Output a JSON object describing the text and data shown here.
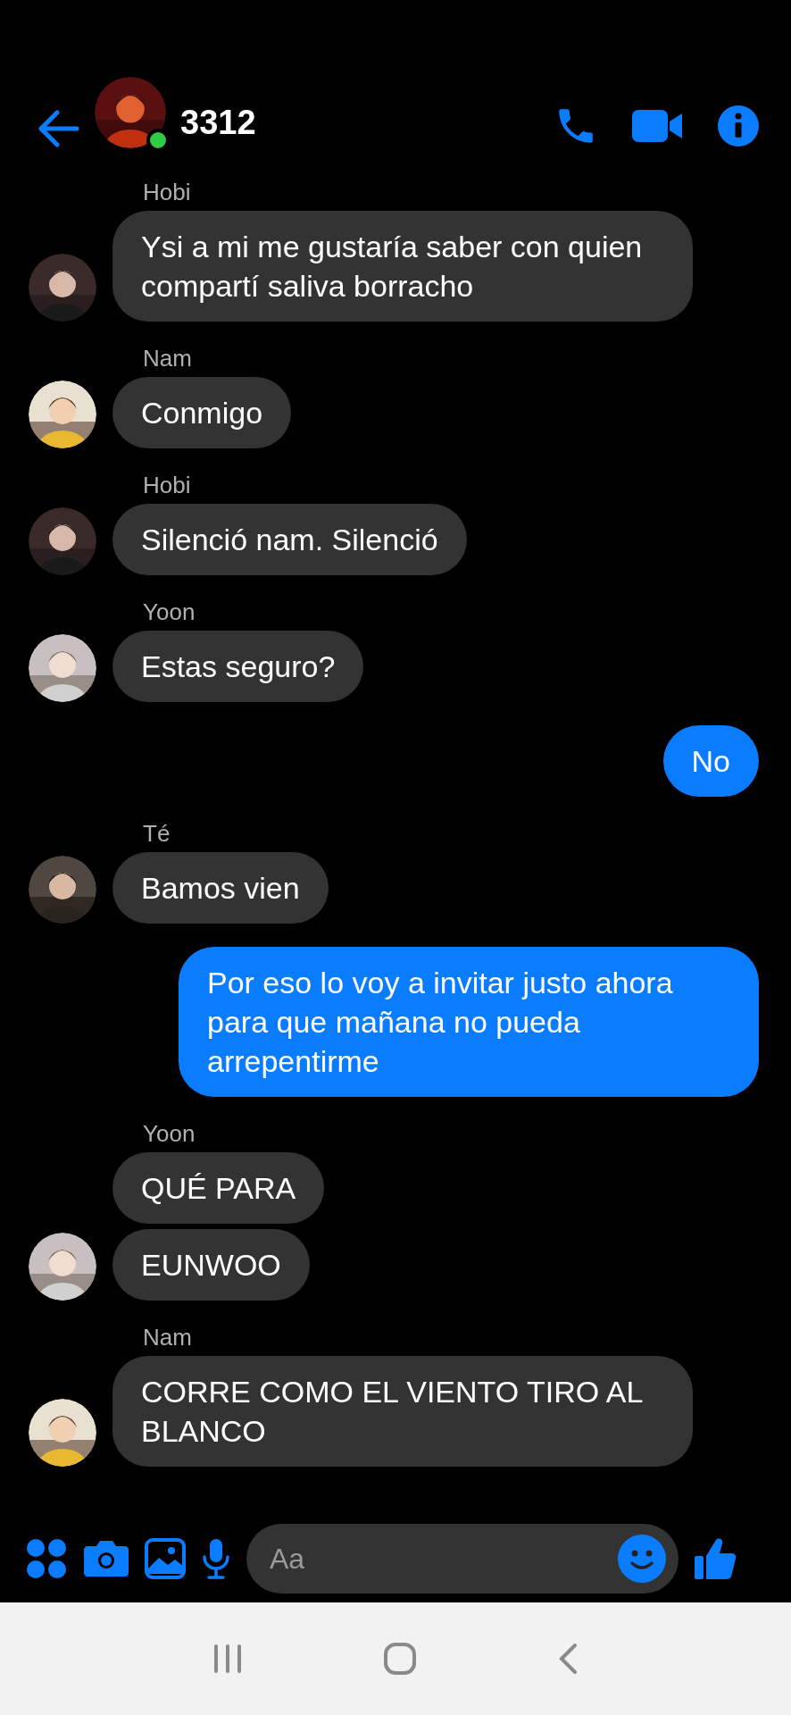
{
  "header": {
    "title": "3312",
    "online": true
  },
  "messages": [
    {
      "kind": "incoming",
      "sender": "Hobi",
      "texts": [
        "Ysi a mi me gustaría saber con quien compartí saliva borracho"
      ]
    },
    {
      "kind": "incoming",
      "sender": "Nam",
      "texts": [
        "Conmigo"
      ]
    },
    {
      "kind": "incoming",
      "sender": "Hobi",
      "texts": [
        "Silenció nam. Silenció"
      ]
    },
    {
      "kind": "incoming",
      "sender": "Yoon",
      "texts": [
        "Estas seguro?"
      ]
    },
    {
      "kind": "outgoing",
      "texts": [
        "No"
      ]
    },
    {
      "kind": "incoming",
      "sender": "Té",
      "texts": [
        "Bamos vien"
      ]
    },
    {
      "kind": "outgoing",
      "texts": [
        "Por eso lo voy a invitar justo ahora para que mañana no pueda arrepentirme"
      ]
    },
    {
      "kind": "incoming",
      "sender": "Yoon",
      "texts": [
        "QUÉ PARA",
        "EUNWOO"
      ]
    },
    {
      "kind": "incoming",
      "sender": "Nam",
      "texts": [
        "CORRE COMO EL VIENTO TIRO AL BLANCO"
      ]
    }
  ],
  "composer": {
    "placeholder": "Aa"
  }
}
